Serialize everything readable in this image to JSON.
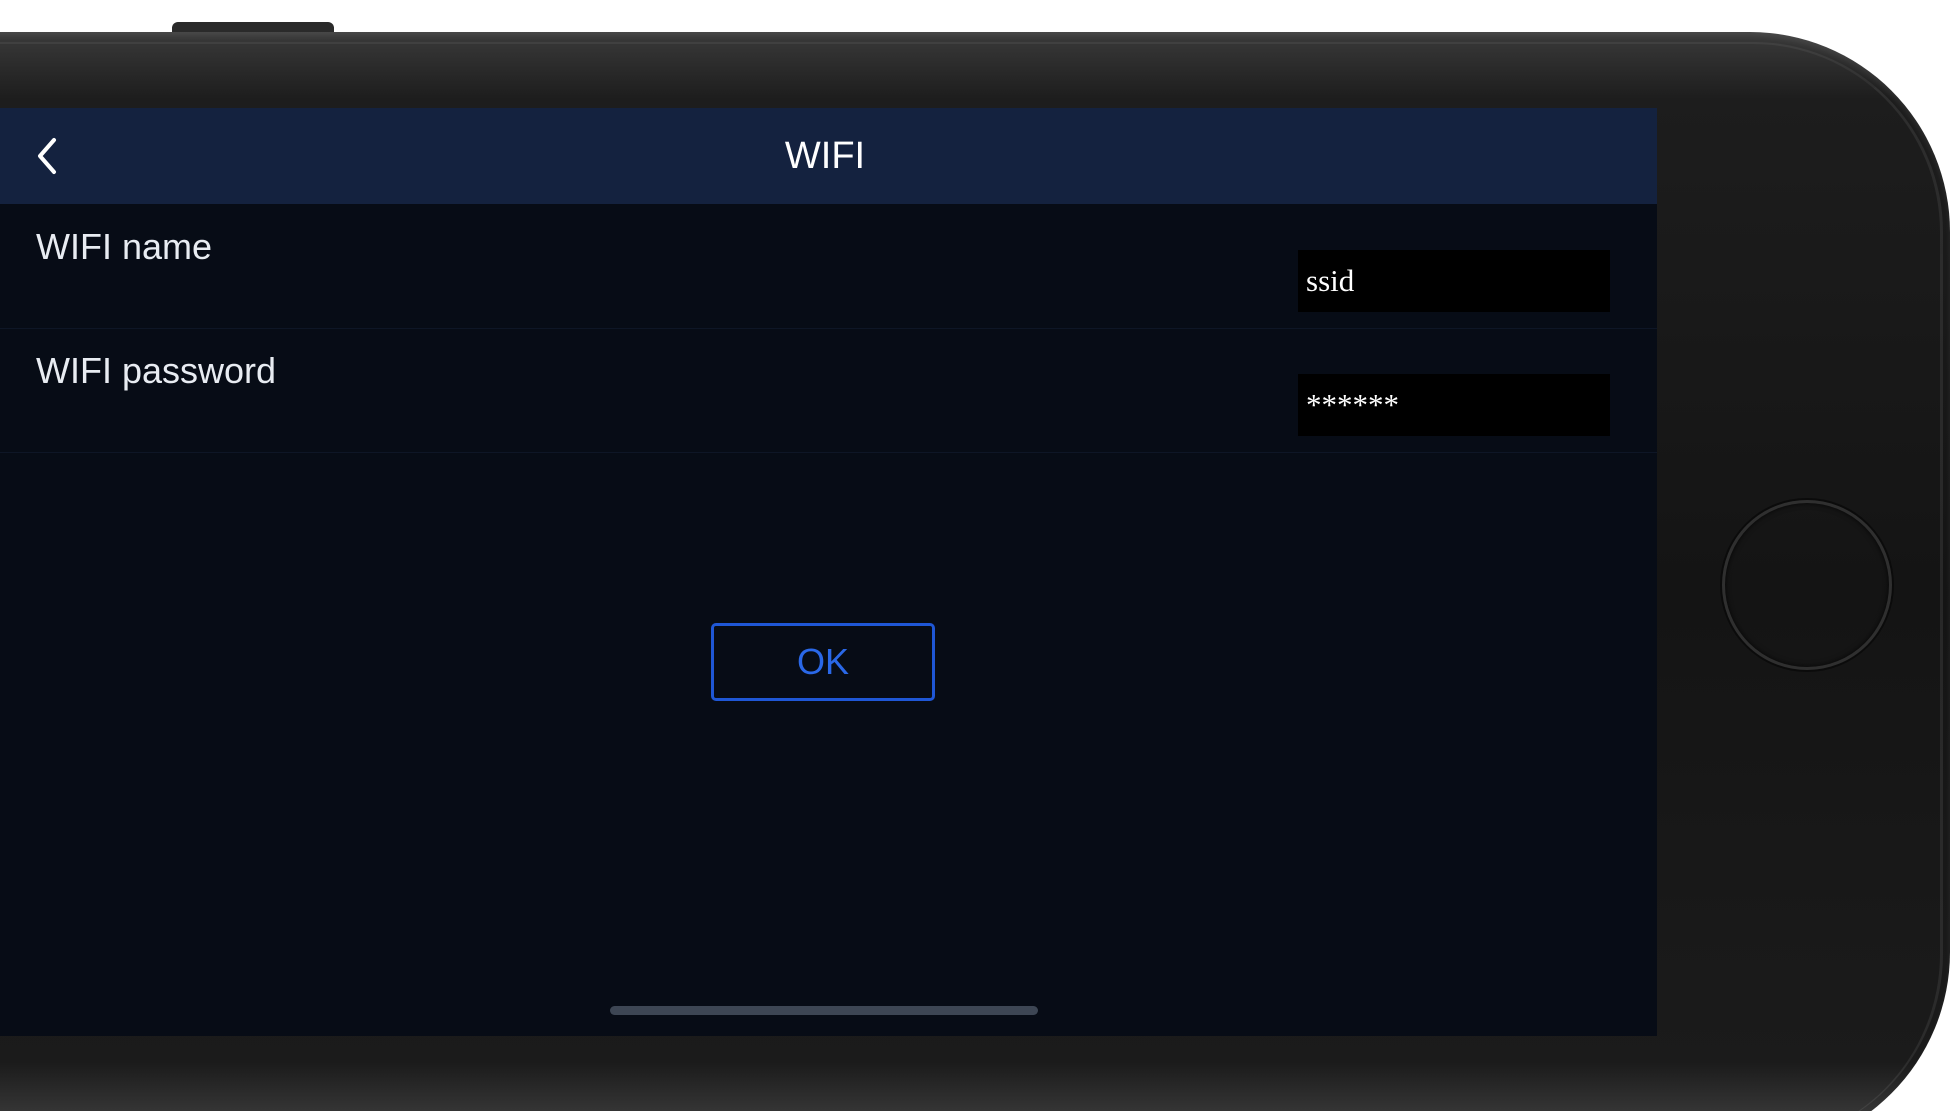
{
  "nav": {
    "title": "WIFI",
    "back_icon": "chevron-left-icon"
  },
  "form": {
    "wifi_name_label": "WIFI name",
    "wifi_name_value": "ssid",
    "wifi_password_label": "WIFI password",
    "wifi_password_value": "******"
  },
  "actions": {
    "ok_label": "OK"
  },
  "colors": {
    "nav_background": "#14223f",
    "screen_background": "#070c16",
    "input_background": "#000000",
    "accent": "#1f57d6"
  }
}
